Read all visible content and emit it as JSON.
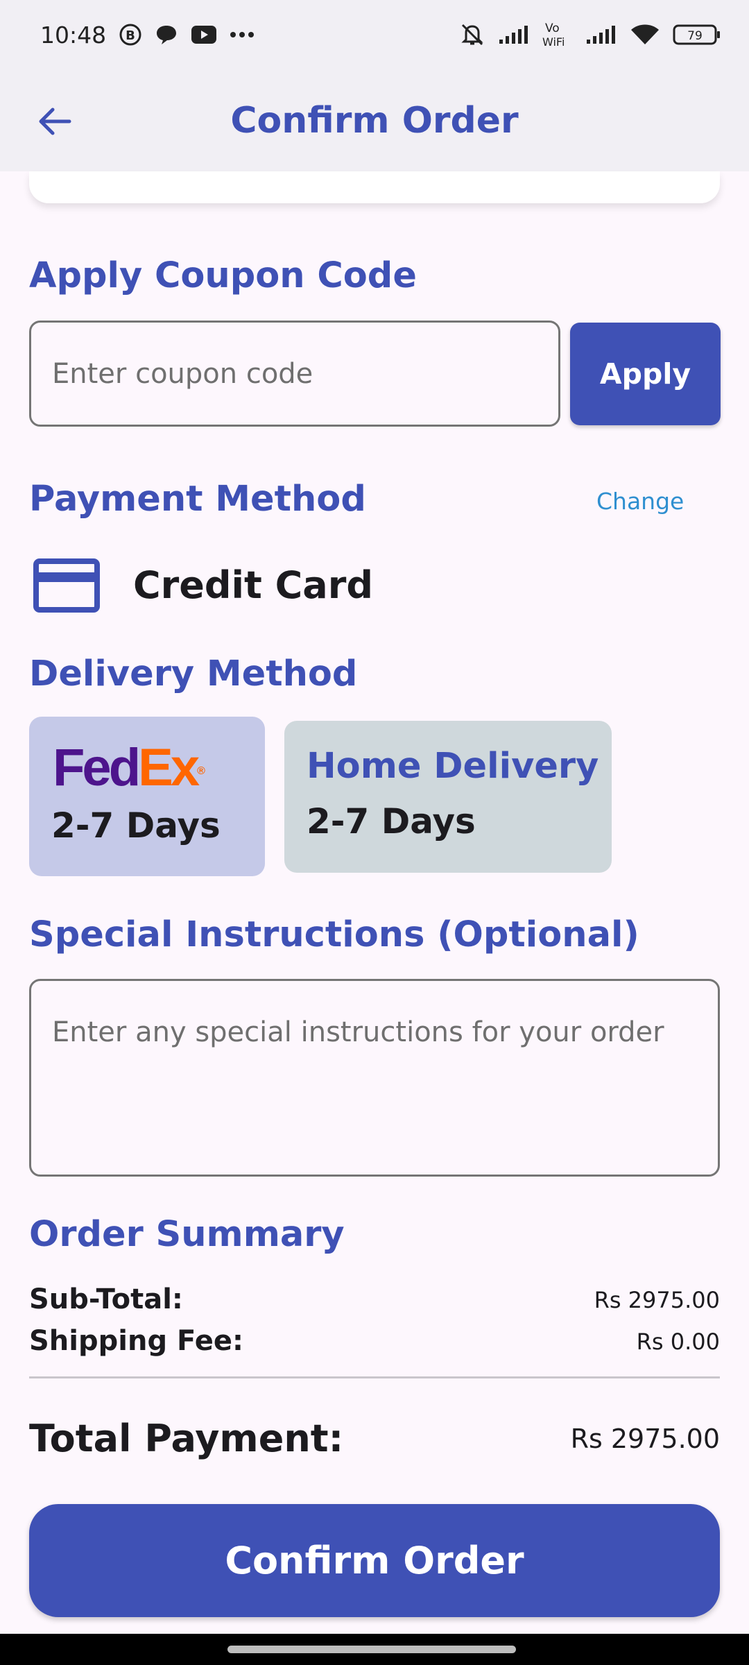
{
  "status_bar": {
    "time": "10:48",
    "battery": "79",
    "vowifi": "Vo WiFi",
    "icons": [
      "b-icon",
      "chat-icon",
      "youtube-icon",
      "more-icon",
      "bell-muted-icon",
      "signal-icon",
      "vowifi-icon",
      "signal-icon",
      "wifi-icon",
      "battery-icon"
    ]
  },
  "app_bar": {
    "title": "Confirm Order",
    "back_icon": "arrow-left-icon"
  },
  "coupon": {
    "title": "Apply Coupon Code",
    "placeholder": "Enter coupon code",
    "apply_label": "Apply"
  },
  "payment": {
    "title": "Payment Method",
    "change_label": "Change",
    "method_icon": "credit-card-icon",
    "method_label": "Credit Card"
  },
  "delivery": {
    "title": "Delivery Method",
    "options": [
      {
        "logo_fed": "Fed",
        "logo_ex": "Ex",
        "logo_reg": "®",
        "days": "2-7 Days",
        "selected": true
      },
      {
        "label": "Home Delivery",
        "days": "2-7 Days",
        "selected": false
      }
    ]
  },
  "instructions": {
    "title": "Special Instructions (Optional)",
    "placeholder": "Enter any special instructions for your order"
  },
  "summary": {
    "title": "Order Summary",
    "subtotal_label": "Sub-Total:",
    "subtotal_value": "Rs 2975.00",
    "shipping_label": "Shipping Fee:",
    "shipping_value": "Rs 0.00",
    "total_label": "Total Payment:",
    "total_value": "Rs 2975.00"
  },
  "confirm_label": "Confirm Order",
  "colors": {
    "accent": "#3f51b5",
    "background": "#fdf7fd",
    "fedex_purple": "#4d148c",
    "fedex_orange": "#ff6600",
    "selected_card": "#c5c9e8",
    "unselected_card": "#cfd8dc",
    "link": "#2f8fd0"
  }
}
